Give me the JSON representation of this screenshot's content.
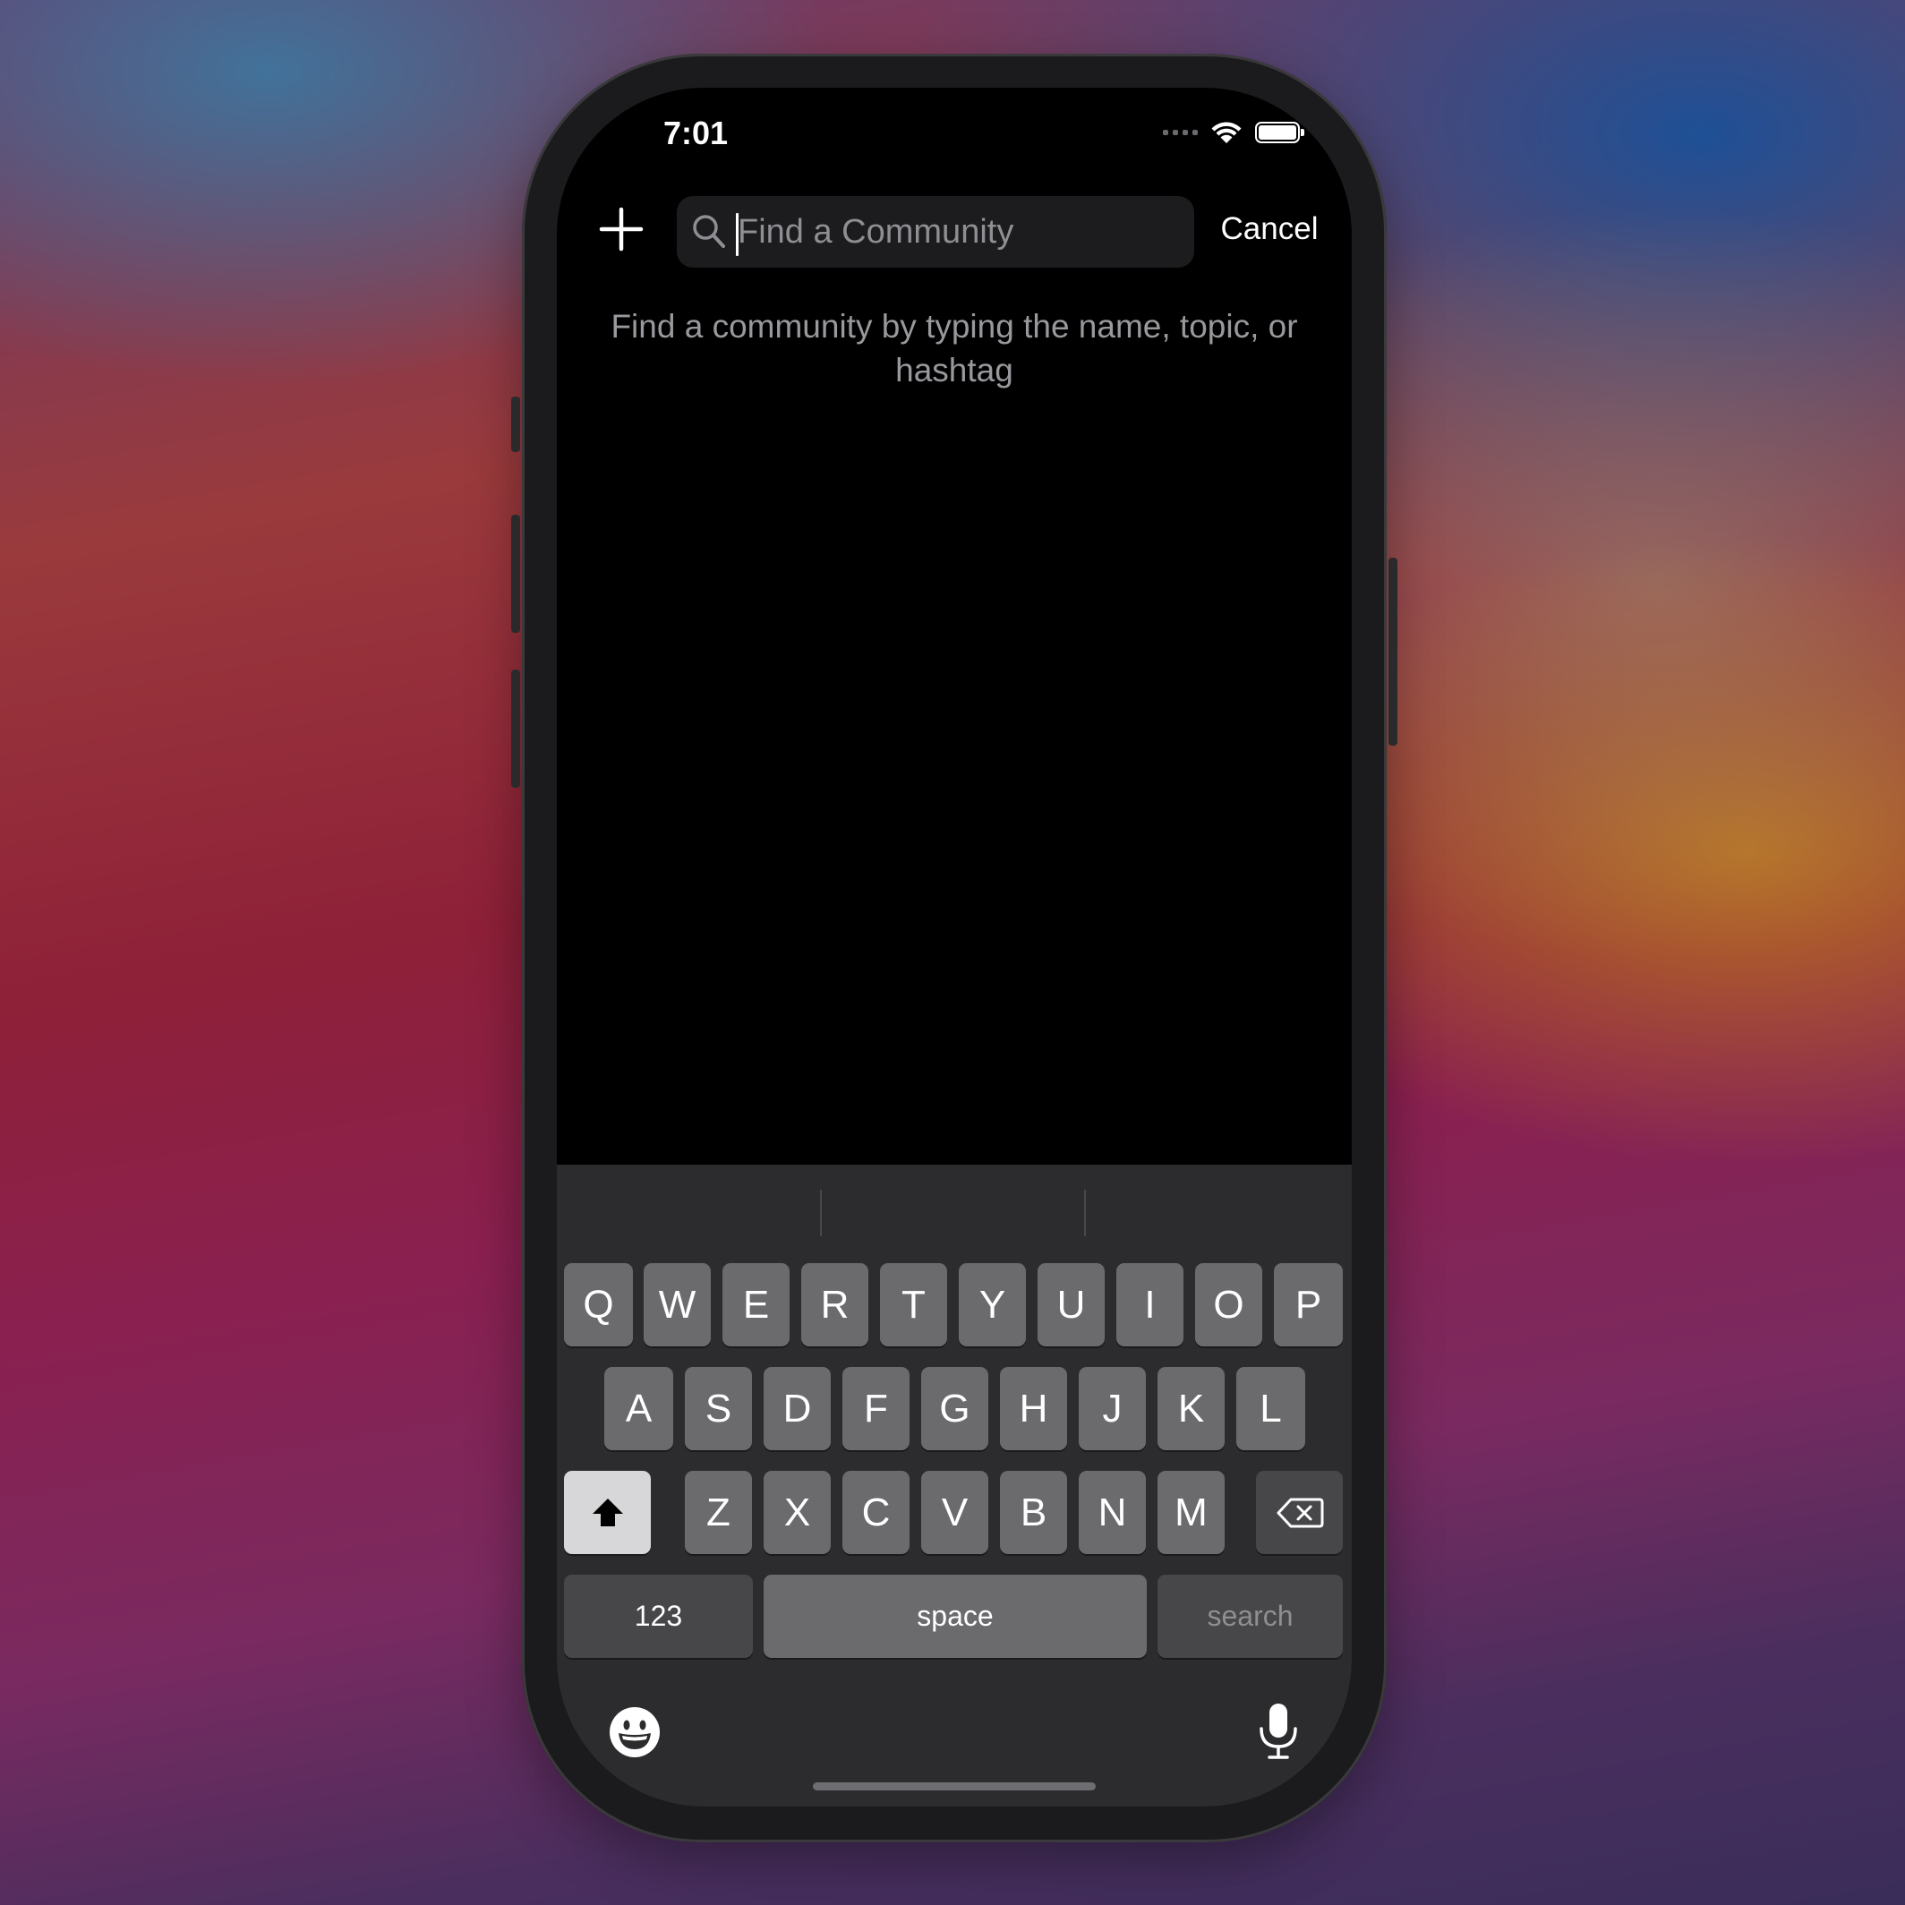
{
  "status_bar": {
    "time": "7:01"
  },
  "header": {
    "add_icon": "plus-icon",
    "search_placeholder": "Find a Community",
    "search_value": "",
    "cancel_label": "Cancel"
  },
  "hint_text": "Find a community by typing the name, topic, or hashtag",
  "keyboard": {
    "row1": [
      "Q",
      "W",
      "E",
      "R",
      "T",
      "Y",
      "U",
      "I",
      "O",
      "P"
    ],
    "row2": [
      "A",
      "S",
      "D",
      "F",
      "G",
      "H",
      "J",
      "K",
      "L"
    ],
    "row3": [
      "Z",
      "X",
      "C",
      "V",
      "B",
      "N",
      "M"
    ],
    "numbers_label": "123",
    "space_label": "space",
    "return_label": "search"
  }
}
